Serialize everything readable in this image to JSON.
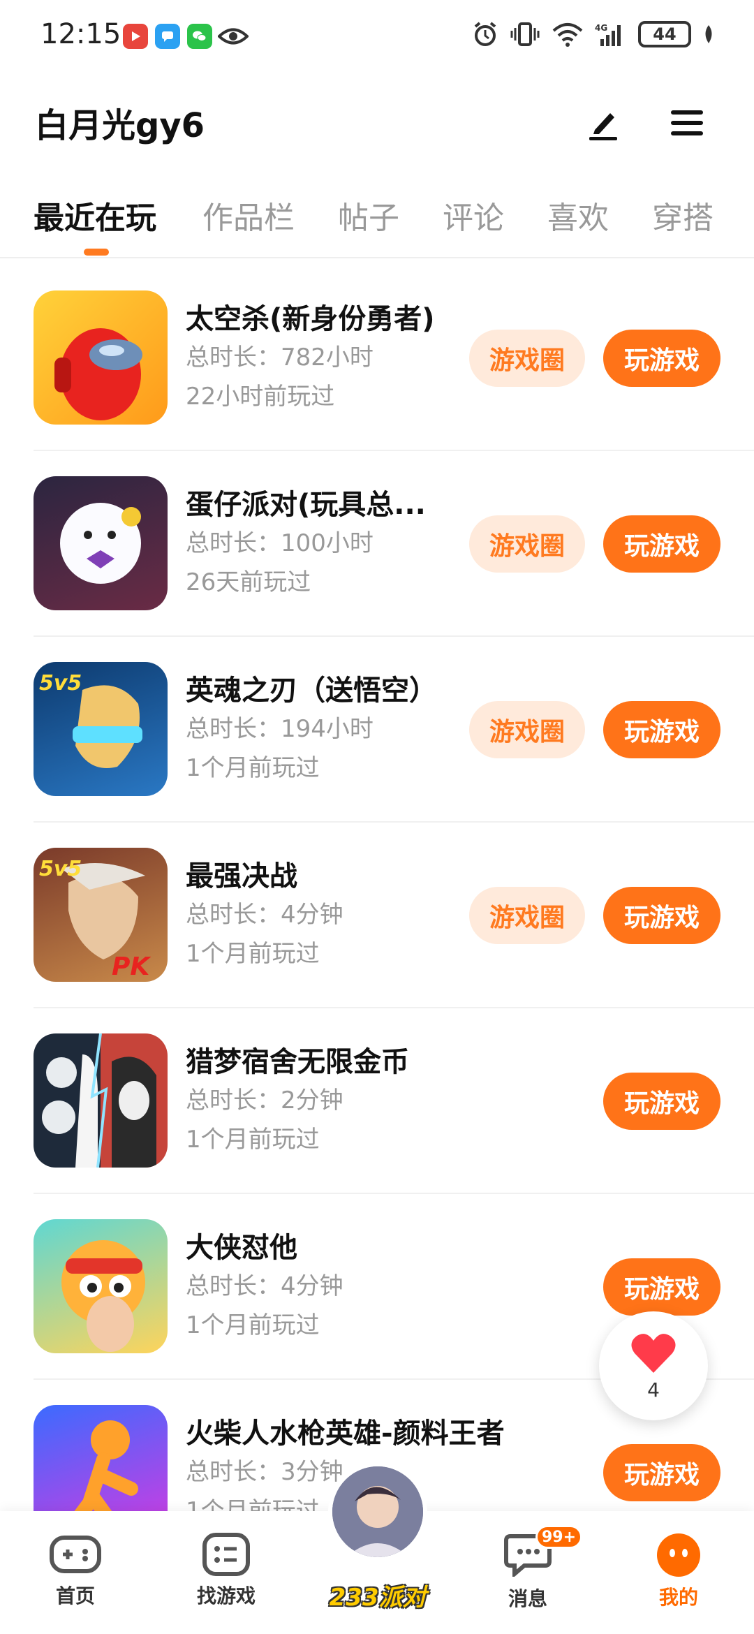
{
  "status_bar": {
    "time": "12:15",
    "battery": "44",
    "network": "4G"
  },
  "header": {
    "user_name": "白月光gy6",
    "edit_icon": "pencil-icon",
    "menu_icon": "hamburger-menu-icon"
  },
  "tabs": [
    {
      "label": "最近在玩",
      "active": true
    },
    {
      "label": "作品栏",
      "active": false
    },
    {
      "label": "帖子",
      "active": false
    },
    {
      "label": "评论",
      "active": false
    },
    {
      "label": "喜欢",
      "active": false
    },
    {
      "label": "穿搭",
      "active": false
    }
  ],
  "games": [
    {
      "title": "太空杀(新身份勇者)",
      "duration": "总时长：782小时",
      "last_played": "22小时前玩过",
      "circle_label": "游戏圈",
      "play_label": "玩游戏"
    },
    {
      "title": "蛋仔派对(玩具总...",
      "duration": "总时长：100小时",
      "last_played": "26天前玩过",
      "circle_label": "游戏圈",
      "play_label": "玩游戏"
    },
    {
      "title": "英魂之刃（送悟空）",
      "duration": "总时长：194小时",
      "last_played": "1个月前玩过",
      "circle_label": "游戏圈",
      "play_label": "玩游戏"
    },
    {
      "title": "最强决战",
      "duration": "总时长：4分钟",
      "last_played": "1个月前玩过",
      "circle_label": "游戏圈",
      "play_label": "玩游戏"
    },
    {
      "title": "猎梦宿舍无限金币",
      "duration": "总时长：2分钟",
      "last_played": "1个月前玩过",
      "play_label": "玩游戏"
    },
    {
      "title": "大侠怼他",
      "duration": "总时长：4分钟",
      "last_played": "1个月前玩过",
      "play_label": "玩游戏"
    },
    {
      "title": "火柴人水枪英雄-颜料王者",
      "duration": "总时长：3分钟",
      "last_played": "1个月前玩过",
      "play_label": "玩游戏"
    }
  ],
  "like_float": {
    "count": "4"
  },
  "bottom_nav": {
    "home": "首页",
    "find": "找游戏",
    "center": "233派对",
    "messages": "消息",
    "messages_badge": "99+",
    "me": "我的"
  },
  "colors": {
    "accent": "#ff7318",
    "accent_light": "#ffeadb"
  }
}
